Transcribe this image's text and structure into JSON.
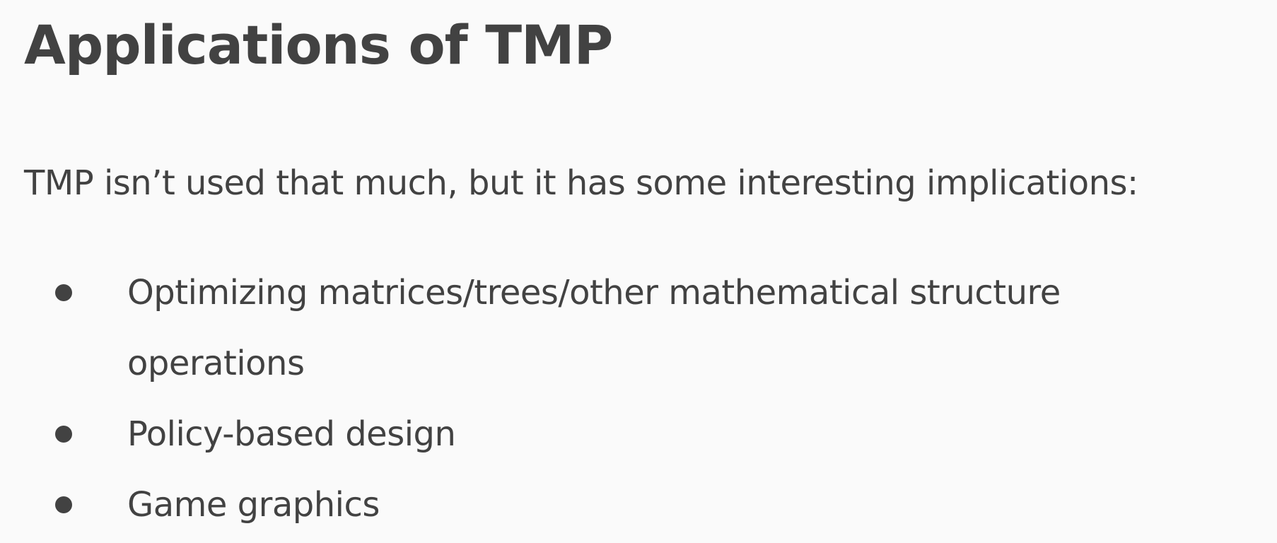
{
  "slide": {
    "title": "Applications of TMP",
    "intro": "TMP isn’t used that much, but it has some interesting implications:",
    "bullets": [
      {
        "text": "Optimizing matrices/trees/other mathematical structure operations"
      },
      {
        "text": "Policy-based design"
      },
      {
        "text": "Game graphics"
      }
    ]
  }
}
